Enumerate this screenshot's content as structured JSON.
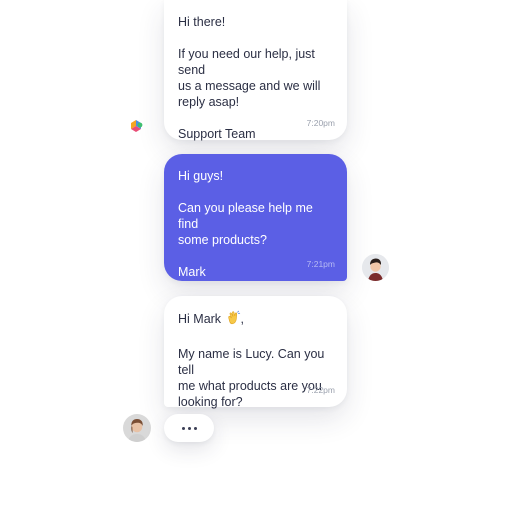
{
  "chat": {
    "msg1": {
      "greeting": "Hi there!",
      "body": "If you need our help, just send\nus a message and we will\nreply asap!",
      "signature": "Support Team",
      "time": "7:20pm"
    },
    "msg2": {
      "greeting": "Hi guys!",
      "body": "Can you please help me find\nsome products?",
      "signature": "Mark",
      "time": "7:21pm"
    },
    "msg3": {
      "greeting_prefix": "Hi Mark",
      "greeting_suffix": ",",
      "emoji_name": "waving-hand-icon",
      "body": "My name is Lucy. Can you tell\nme what products are you\nlooking for?",
      "time": "7:22pm"
    },
    "typing": {
      "icon": "typing-dots-icon"
    }
  },
  "colors": {
    "user_bubble": "#5b5fe5",
    "agent_bubble": "#ffffff",
    "text": "#2b2f44",
    "timestamp": "#9aa0ad"
  }
}
